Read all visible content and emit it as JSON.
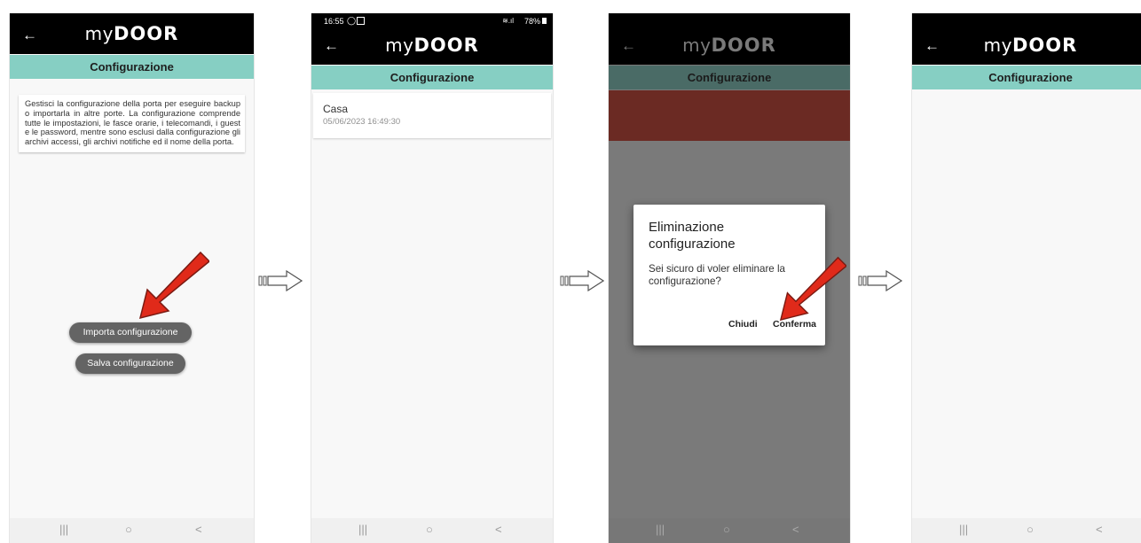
{
  "app": {
    "logo_my": "my",
    "logo_door": "DOOR",
    "back_icon": "←",
    "page_title": "Configurazione"
  },
  "screen1": {
    "description": "Gestisci la configurazione della porta per eseguire backup o importarla in altre porte. La configurazione comprende tutte le impostazioni, le fasce orarie, i telecomandi, i guest e le password, mentre sono esclusi dalla configurazione gli archivi accessi, gli archivi notifiche ed il nome della porta.",
    "import_button": "Importa configurazione",
    "save_button": "Salva configurazione"
  },
  "screen2": {
    "status_time": "16:55",
    "status_battery": "78%",
    "item_name": "Casa",
    "item_date": "05/06/2023 16:49:30"
  },
  "screen3": {
    "dialog_title": "Eliminazione configurazione",
    "dialog_message": "Sei sicuro di voler eliminare la configurazione?",
    "close_button": "Chiudi",
    "confirm_button": "Conferma"
  },
  "navbar": {
    "recents_icon": "|||",
    "home_icon": "○",
    "back_icon": "<"
  },
  "colors": {
    "accent_teal": "#86cfc3",
    "appbar": "#000000",
    "pill_button": "#646464",
    "highlight_arrow": "#e02a1a"
  }
}
